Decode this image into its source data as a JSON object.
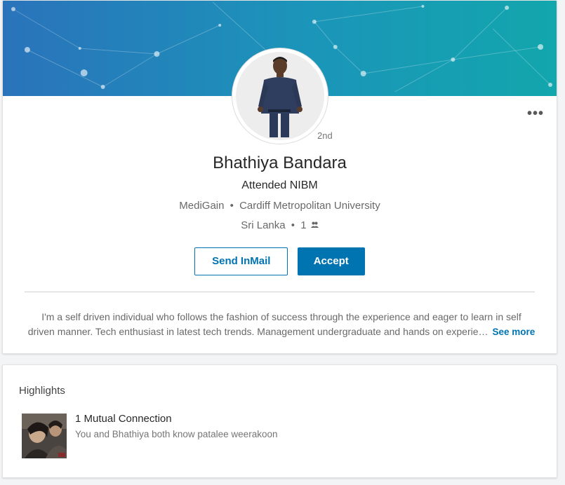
{
  "profile": {
    "name": "Bhathiya Bandara",
    "degree": "2nd",
    "headline": "Attended NIBM",
    "company": "MediGain",
    "school": "Cardiff Metropolitan University",
    "location": "Sri Lanka",
    "separator": "•",
    "connections": "1",
    "connections_icon": "people-icon",
    "overflow_label": "•••"
  },
  "actions": {
    "send_inmail": "Send InMail",
    "accept": "Accept"
  },
  "summary": {
    "line1": "I'm a self driven individual who follows the fashion of success through the experience and eager to learn in self",
    "line2": "driven manner. Tech enthusiast in latest tech trends. Management undergraduate and hands on experie…",
    "see_more": "See more"
  },
  "highlights": {
    "title": "Highlights",
    "heading": "1 Mutual Connection",
    "subtext": "You and Bhathiya both know patalee weerakoon"
  },
  "colors": {
    "accent": "#0073b1",
    "banner_start": "#2a6fb8",
    "banner_end": "#14a3b0"
  }
}
